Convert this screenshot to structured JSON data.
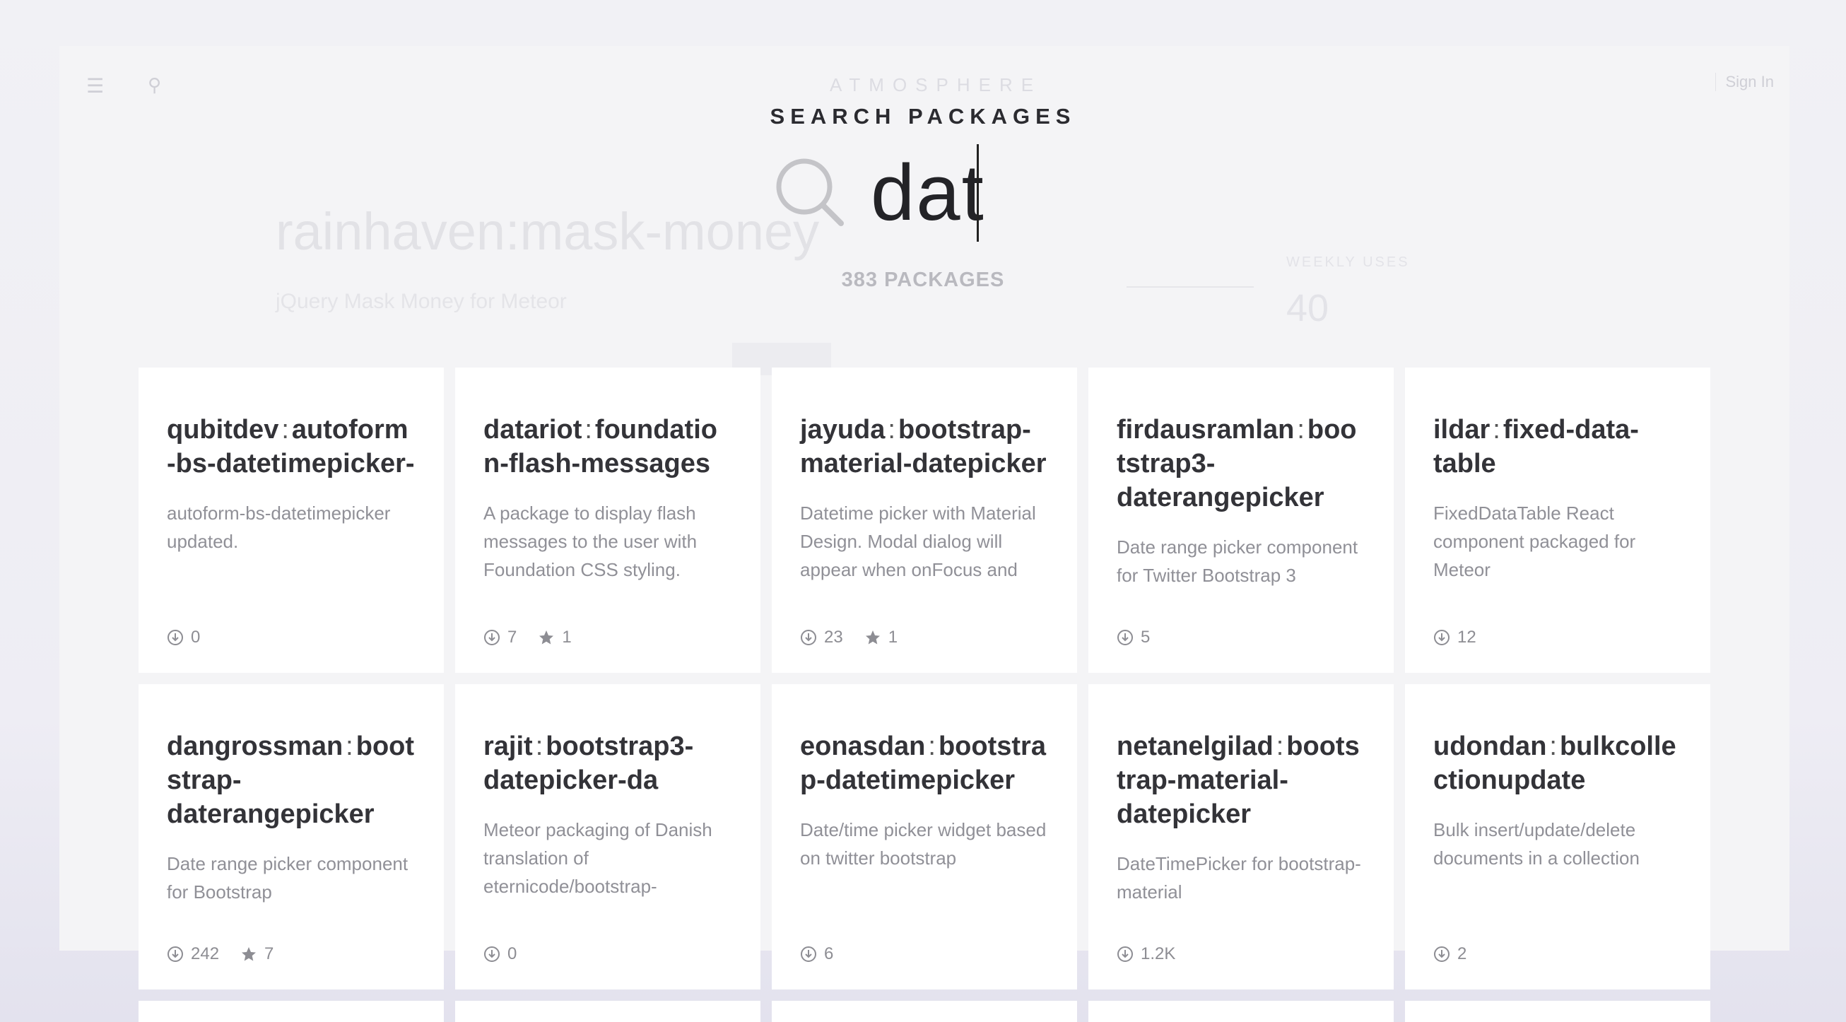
{
  "background": {
    "logo": "ATMOSPHERE",
    "signin": "Sign In",
    "package_title": "rainhaven:mask-money",
    "package_subtitle": "jQuery Mask Money for Meteor",
    "stat_label": "WEEKLY USES",
    "stat_value": "40"
  },
  "overlay": {
    "heading": "SEARCH PACKAGES",
    "query": "dat",
    "results_count": "383 PACKAGES"
  },
  "cards": [
    {
      "author": "qubitdev",
      "name": "autoform-bs-datetimepicker-",
      "description": "autoform-bs-datetimepicker updated.",
      "installs": "0",
      "stars": null
    },
    {
      "author": "datariot",
      "name": "foundation-flash-messages",
      "description": "A package to display flash messages to the user with Foundation CSS styling.",
      "installs": "7",
      "stars": "1"
    },
    {
      "author": "jayuda",
      "name": "bootstrap-material-datepicker",
      "description": "Datetime picker with Material Design. Modal dialog will appear when onFocus and",
      "installs": "23",
      "stars": "1"
    },
    {
      "author": "firdausramlan",
      "name": "bootstrap3-daterangepicker",
      "description": "Date range picker component for Twitter Bootstrap 3",
      "installs": "5",
      "stars": null
    },
    {
      "author": "ildar",
      "name": "fixed-data-table",
      "description": "FixedDataTable React component packaged for Meteor",
      "installs": "12",
      "stars": null
    },
    {
      "author": "dangrossman",
      "name": "bootstrap-daterangepicker",
      "description": "Date range picker component for Bootstrap",
      "installs": "242",
      "stars": "7"
    },
    {
      "author": "rajit",
      "name": "bootstrap3-datepicker-da",
      "description": "Meteor packaging of Danish translation of eternicode/bootstrap-",
      "installs": "0",
      "stars": null
    },
    {
      "author": "eonasdan",
      "name": "bootstrap-datetimepicker",
      "description": "Date/time picker widget based on twitter bootstrap",
      "installs": "6",
      "stars": null
    },
    {
      "author": "netanelgilad",
      "name": "bootstrap-material-datepicker",
      "description": "DateTimePicker for bootstrap-material",
      "installs": "1.2K",
      "stars": null
    },
    {
      "author": "udondan",
      "name": "bulkcollectionupdate",
      "description": "Bulk insert/update/delete documents in a collection",
      "installs": "2",
      "stars": null
    }
  ]
}
